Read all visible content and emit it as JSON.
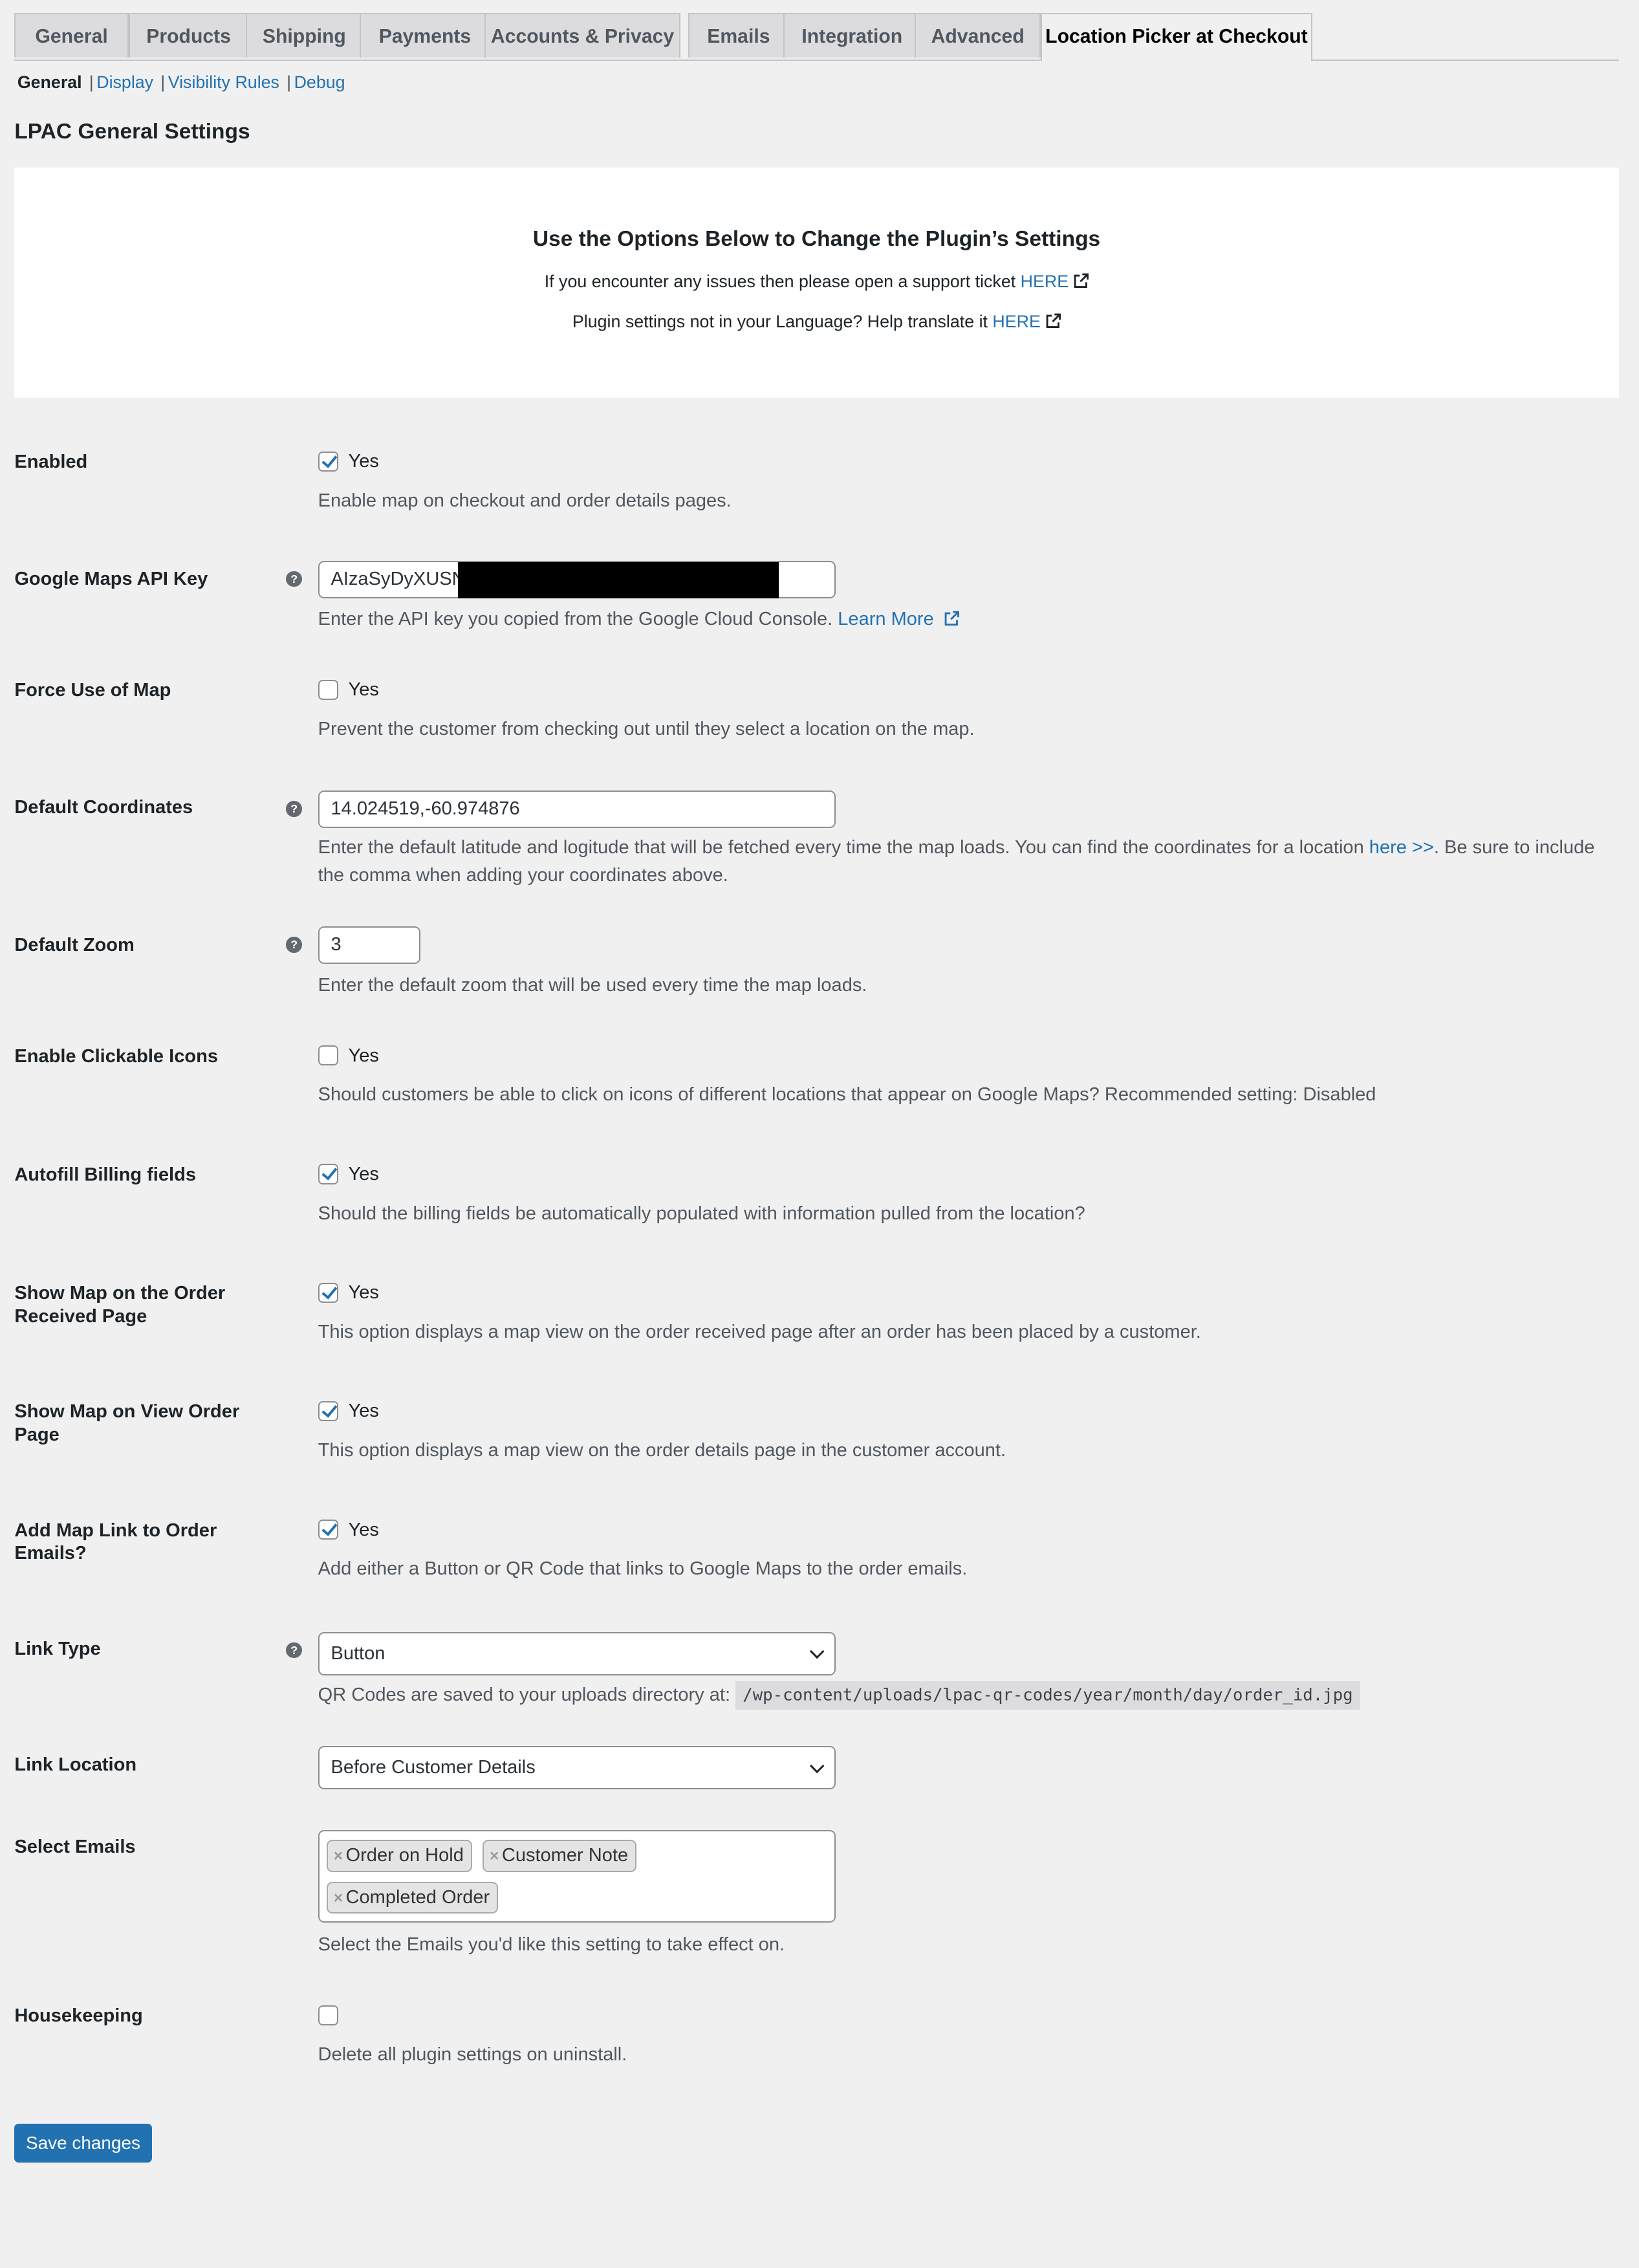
{
  "tabs": [
    "General",
    "Products",
    "Shipping",
    "Payments",
    "Accounts & Privacy",
    "Emails",
    "Integration",
    "Advanced",
    "Location Picker at Checkout"
  ],
  "active_tab": "Location Picker at Checkout",
  "subnav": [
    "General",
    "Display",
    "Visibility Rules",
    "Debug"
  ],
  "page_title": "LPAC General Settings",
  "banner": {
    "heading": "Use the Options Below to Change the Plugin’s Settings",
    "support_text": "If you encounter any issues then please open a support ticket ",
    "support_link": "HERE",
    "translate_text": "Plugin settings not in your Language? Help translate it ",
    "translate_link": "HERE"
  },
  "settings": {
    "enabled": {
      "label": "Enabled",
      "checked": true,
      "option": "Yes",
      "desc": "Enable map on checkout and order details pages."
    },
    "api_key": {
      "label": "Google Maps API Key",
      "value": "AIzaSyDyXUSN",
      "desc": "Enter the API key you copied from the Google Cloud Console. ",
      "link": "Learn More "
    },
    "force_map": {
      "label": "Force Use of Map",
      "checked": false,
      "option": "Yes",
      "desc": "Prevent the customer from checking out until they select a location on the map."
    },
    "coords": {
      "label": "Default Coordinates",
      "value": "14.024519,-60.974876",
      "desc": "Enter the default latitude and logitude that will be fetched every time the map loads. You can find the coordinates for a location ",
      "link": "here >>",
      "desc_after": ". Be sure to include the comma when adding your coordinates above."
    },
    "zoom": {
      "label": "Default Zoom",
      "value": "3",
      "desc": "Enter the default zoom that will be used every time the map loads."
    },
    "clickable": {
      "label": "Enable Clickable Icons",
      "checked": false,
      "option": "Yes",
      "desc": "Should customers be able to click on icons of different locations that appear on Google Maps? Recommended setting: Disabled"
    },
    "autofill": {
      "label": "Autofill Billing fields",
      "checked": true,
      "option": "Yes",
      "desc": "Should the billing fields be automatically populated with information pulled from the location?"
    },
    "received": {
      "label": "Show Map on the Order Received Page",
      "checked": true,
      "option": "Yes",
      "desc": "This option displays a map view on the order received page after an order has been placed by a customer."
    },
    "view_order": {
      "label": "Show Map on View Order Page",
      "checked": true,
      "option": "Yes",
      "desc": "This option displays a map view on the order details page in the customer account."
    },
    "map_link": {
      "label": "Add Map Link to Order Emails?",
      "checked": true,
      "option": "Yes",
      "desc": "Add either a Button or QR Code that links to Google Maps to the order emails."
    },
    "link_type": {
      "label": "Link Type",
      "value": "Button",
      "desc": "QR Codes are saved to your uploads directory at: ",
      "path": "/wp-content/uploads/lpac-qr-codes/year/month/day/order_id.jpg"
    },
    "link_location": {
      "label": "Link Location",
      "value": "Before Customer Details"
    },
    "emails": {
      "label": "Select Emails",
      "selected": [
        "Order on Hold",
        "Customer Note",
        "Completed Order"
      ],
      "desc": "Select the Emails you'd like this setting to take effect on."
    },
    "housekeeping": {
      "label": "Housekeeping",
      "checked": false,
      "desc": "Delete all plugin settings on uninstall."
    }
  },
  "save_label": "Save changes",
  "colors": {
    "accent": "#2271b1",
    "background": "#f0f0f1"
  }
}
